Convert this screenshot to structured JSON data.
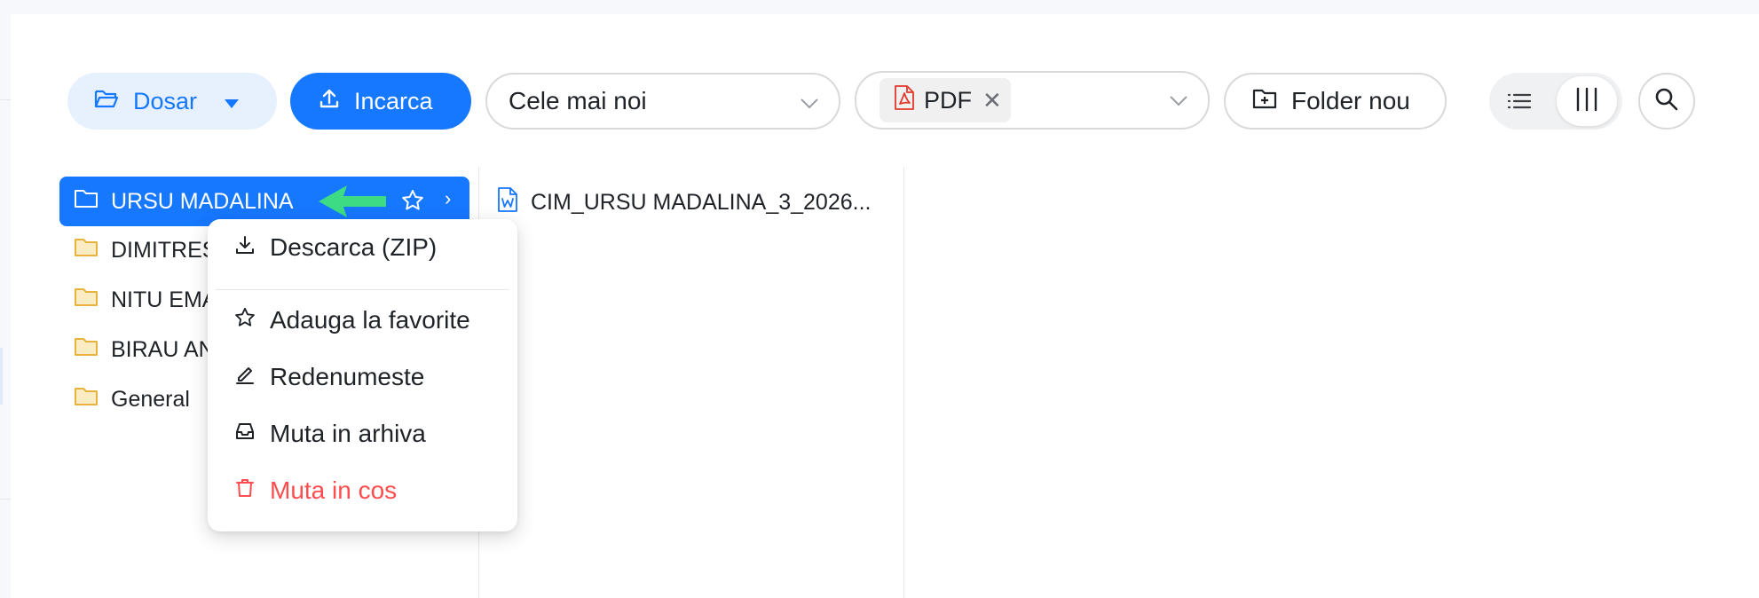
{
  "toolbar": {
    "folder_button": "Dosar",
    "upload_button": "Incarca",
    "sort_select": {
      "value": "Cele mai noi"
    },
    "type_filter": {
      "tag": "PDF"
    },
    "new_folder_button": "Folder nou",
    "view_mode": "columns"
  },
  "folders": [
    {
      "label": "URSU MADALINA",
      "selected": true
    },
    {
      "label": "DIMITRES"
    },
    {
      "label": "NITU EMA"
    },
    {
      "label": "BIRAU AN"
    },
    {
      "label": "General"
    }
  ],
  "files": [
    {
      "label": "CIM_URSU MADALINA_3_2026...",
      "icon": "word-file-icon"
    }
  ],
  "context_menu": {
    "items": [
      {
        "label": "Descarca (ZIP)",
        "icon": "download-icon"
      },
      {
        "label": "Adauga la favorite",
        "icon": "star-icon"
      },
      {
        "label": "Redenumeste",
        "icon": "edit-icon"
      },
      {
        "label": "Muta in arhiva",
        "icon": "archive-icon"
      },
      {
        "label": "Muta in cos",
        "icon": "trash-icon",
        "danger": true
      }
    ]
  },
  "colors": {
    "primary": "#1677ff",
    "primary_light": "#e6f1fd",
    "folder_icon": "#e8b33c",
    "danger": "#ff4d4f",
    "pdf": "#e2382c",
    "annotation_arrow": "#3ddc84"
  }
}
